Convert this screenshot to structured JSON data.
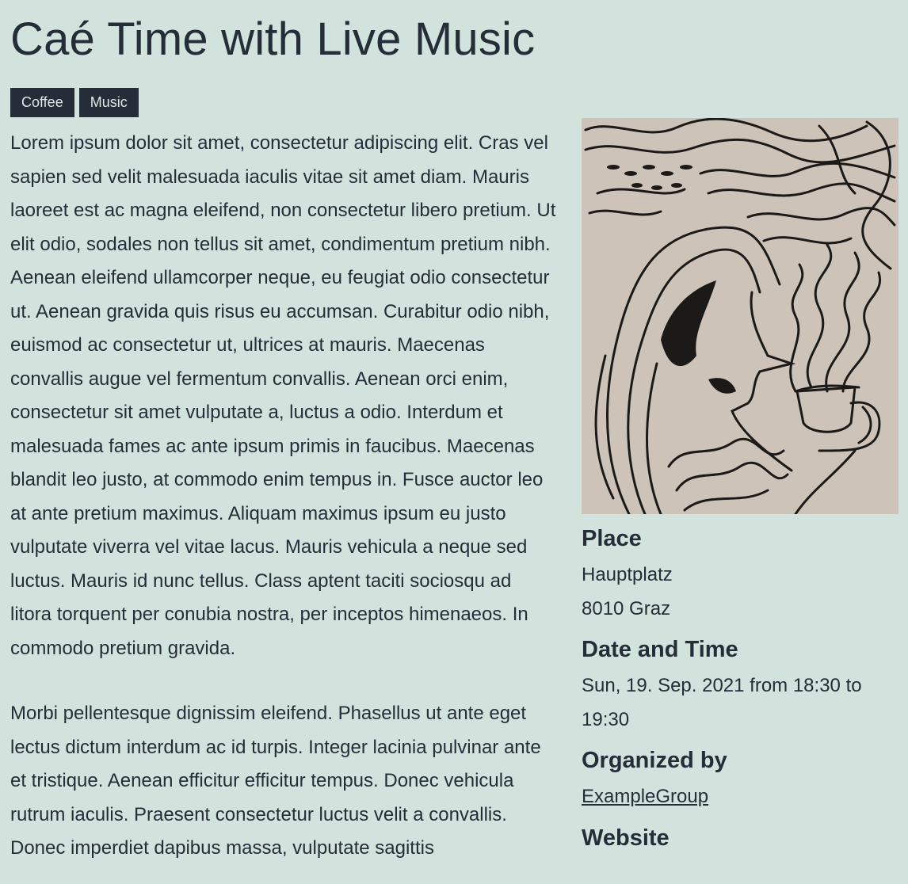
{
  "page": {
    "title": "Caé Time with Live Music"
  },
  "tags": [
    "Coffee",
    "Music"
  ],
  "description": {
    "paragraphs": [
      "Lorem ipsum dolor sit amet, consectetur adipiscing elit. Cras vel sapien sed velit malesuada iaculis vitae sit amet diam. Mauris laoreet est ac magna eleifend, non consectetur libero pretium. Ut elit odio, sodales non tellus sit amet, condimentum pretium nibh. Aenean eleifend ullamcorper neque, eu feugiat odio consectetur ut. Aenean gravida quis risus eu accumsan. Curabitur odio nibh, euismod ac consectetur ut, ultrices at mauris. Maecenas convallis augue vel fermentum convallis. Aenean orci enim, consectetur sit amet vulputate a, luctus a odio. Interdum et malesuada fames ac ante ipsum primis in faucibus. Maecenas blandit leo justo, at commodo enim tempus in. Fusce auctor leo at ante pretium maximus. Aliquam maximus ipsum eu justo vulputate viverra vel vitae lacus. Mauris vehicula a neque sed luctus. Mauris id nunc tellus. Class aptent taciti sociosqu ad litora torquent per conubia nostra, per inceptos himenaeos. In commodo pretium gravida.",
      "Morbi pellentesque dignissim eleifend. Phasellus ut ante eget lectus dictum interdum ac id turpis. Integer lacinia pulvinar ante et tristique. Aenean efficitur efficitur tempus. Donec vehicula rutrum iaculis. Praesent consectetur luctus velit a convallis. Donec imperdiet dapibus massa, vulputate sagittis"
    ]
  },
  "sidebar": {
    "place": {
      "heading": "Place",
      "street": "Hauptplatz",
      "city": "8010 Graz"
    },
    "datetime": {
      "heading": "Date and Time",
      "value": "Sun, 19. Sep. 2021 from 18:30 to 19:30"
    },
    "organizer": {
      "heading": "Organized by",
      "name": "ExampleGroup"
    },
    "website": {
      "heading": "Website"
    }
  },
  "colors": {
    "background": "#d2e3dd",
    "text": "#252d38",
    "tag_background": "#252d38",
    "tag_text": "#dfe8e4",
    "artwork_paper": "#cdc3b8",
    "artwork_ink": "#1c1a18"
  },
  "icons": {
    "event_image": "linocut-woman-coffee-cup-artwork"
  }
}
